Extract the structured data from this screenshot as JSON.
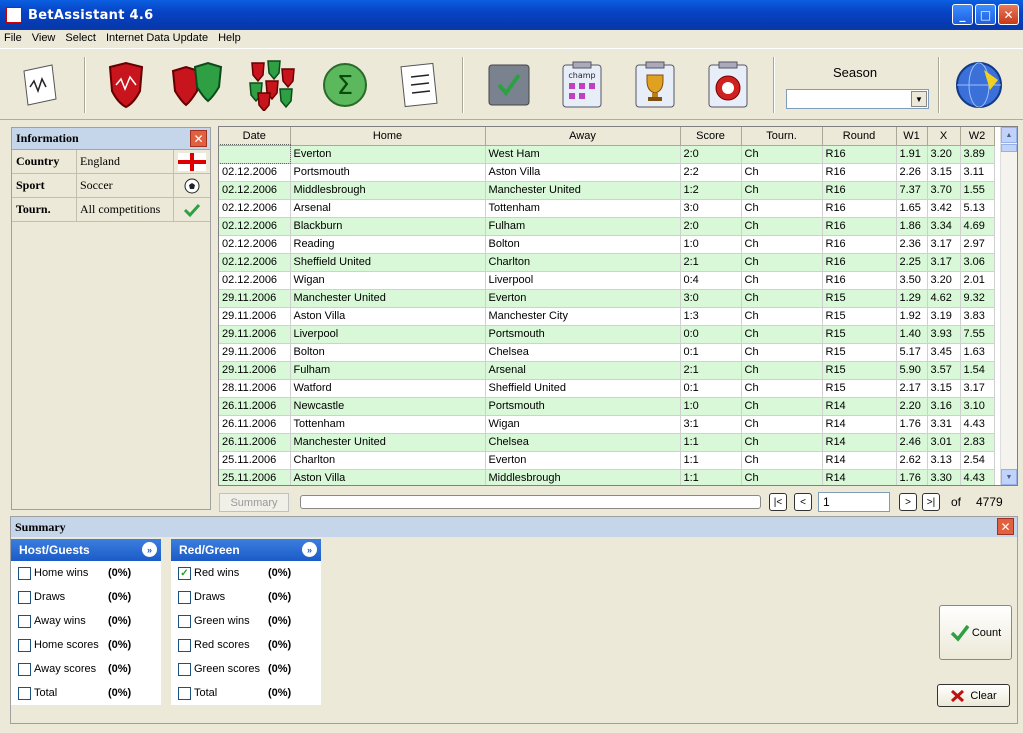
{
  "window": {
    "title": "BetAssistant 4.6",
    "minimize": "_",
    "maximize": "□",
    "close": "✕"
  },
  "menu": [
    "File",
    "View",
    "Select",
    "Internet Data Update",
    "Help"
  ],
  "toolbar": {
    "season_label": "Season",
    "season_value": "",
    "icons": [
      "chart-sheet-icon",
      "red-shield-icon",
      "red-green-shields-icon",
      "multi-shields-icon",
      "sigma-icon",
      "numbered-list-icon",
      "checkmark-icon",
      "championship-icon",
      "trophy-icon",
      "uefa-icon",
      "globe-icon"
    ],
    "champ_label": "champ"
  },
  "info": {
    "title": "Information",
    "rows": [
      {
        "key": "Country",
        "value": "England",
        "icon": "england-flag-icon"
      },
      {
        "key": "Sport",
        "value": "Soccer",
        "icon": "soccer-ball-icon"
      },
      {
        "key": "Tourn.",
        "value": "All competitions",
        "icon": "green-check-icon"
      }
    ]
  },
  "grid": {
    "columns": [
      "Date",
      "Home",
      "Away",
      "Score",
      "Tourn.",
      "Round",
      "W1",
      "X",
      "W2"
    ],
    "rows": [
      [
        "",
        "Everton",
        "West Ham",
        "2:0",
        "Ch",
        "R16",
        "1.91",
        "3.20",
        "3.89"
      ],
      [
        "02.12.2006",
        "Portsmouth",
        "Aston Villa",
        "2:2",
        "Ch",
        "R16",
        "2.26",
        "3.15",
        "3.11"
      ],
      [
        "02.12.2006",
        "Middlesbrough",
        "Manchester United",
        "1:2",
        "Ch",
        "R16",
        "7.37",
        "3.70",
        "1.55"
      ],
      [
        "02.12.2006",
        "Arsenal",
        "Tottenham",
        "3:0",
        "Ch",
        "R16",
        "1.65",
        "3.42",
        "5.13"
      ],
      [
        "02.12.2006",
        "Blackburn",
        "Fulham",
        "2:0",
        "Ch",
        "R16",
        "1.86",
        "3.34",
        "4.69"
      ],
      [
        "02.12.2006",
        "Reading",
        "Bolton",
        "1:0",
        "Ch",
        "R16",
        "2.36",
        "3.17",
        "2.97"
      ],
      [
        "02.12.2006",
        "Sheffield United",
        "Charlton",
        "2:1",
        "Ch",
        "R16",
        "2.25",
        "3.17",
        "3.06"
      ],
      [
        "02.12.2006",
        "Wigan",
        "Liverpool",
        "0:4",
        "Ch",
        "R16",
        "3.50",
        "3.20",
        "2.01"
      ],
      [
        "29.11.2006",
        "Manchester United",
        "Everton",
        "3:0",
        "Ch",
        "R15",
        "1.29",
        "4.62",
        "9.32"
      ],
      [
        "29.11.2006",
        "Aston Villa",
        "Manchester City",
        "1:3",
        "Ch",
        "R15",
        "1.92",
        "3.19",
        "3.83"
      ],
      [
        "29.11.2006",
        "Liverpool",
        "Portsmouth",
        "0:0",
        "Ch",
        "R15",
        "1.40",
        "3.93",
        "7.55"
      ],
      [
        "29.11.2006",
        "Bolton",
        "Chelsea",
        "0:1",
        "Ch",
        "R15",
        "5.17",
        "3.45",
        "1.63"
      ],
      [
        "29.11.2006",
        "Fulham",
        "Arsenal",
        "2:1",
        "Ch",
        "R15",
        "5.90",
        "3.57",
        "1.54"
      ],
      [
        "28.11.2006",
        "Watford",
        "Sheffield United",
        "0:1",
        "Ch",
        "R15",
        "2.17",
        "3.15",
        "3.17"
      ],
      [
        "26.11.2006",
        "Newcastle",
        "Portsmouth",
        "1:0",
        "Ch",
        "R14",
        "2.20",
        "3.16",
        "3.10"
      ],
      [
        "26.11.2006",
        "Tottenham",
        "Wigan",
        "3:1",
        "Ch",
        "R14",
        "1.76",
        "3.31",
        "4.43"
      ],
      [
        "26.11.2006",
        "Manchester United",
        "Chelsea",
        "1:1",
        "Ch",
        "R14",
        "2.46",
        "3.01",
        "2.83"
      ],
      [
        "25.11.2006",
        "Charlton",
        "Everton",
        "1:1",
        "Ch",
        "R14",
        "2.62",
        "3.13",
        "2.54"
      ],
      [
        "25.11.2006",
        "Aston Villa",
        "Middlesbrough",
        "1:1",
        "Ch",
        "R14",
        "1.76",
        "3.30",
        "4.43"
      ]
    ]
  },
  "pager": {
    "summary_label": "Summary",
    "first": "|<",
    "prev": "<",
    "page": "1",
    "next": ">",
    "last": ">|",
    "of_label": "of",
    "total": "4779"
  },
  "summary": {
    "title": "Summary",
    "host_guests": {
      "title": "Host/Guests",
      "items": [
        {
          "label": "Home wins",
          "pct": "(0%)",
          "checked": false
        },
        {
          "label": "Draws",
          "pct": "(0%)",
          "checked": false
        },
        {
          "label": "Away wins",
          "pct": "(0%)",
          "checked": false
        },
        {
          "label": "Home scores",
          "pct": "(0%)",
          "checked": false
        },
        {
          "label": "Away scores",
          "pct": "(0%)",
          "checked": false
        },
        {
          "label": "Total",
          "pct": "(0%)",
          "checked": false
        }
      ]
    },
    "red_green": {
      "title": "Red/Green",
      "items": [
        {
          "label": "Red wins",
          "pct": "(0%)",
          "checked": true
        },
        {
          "label": "Draws",
          "pct": "(0%)",
          "checked": false
        },
        {
          "label": "Green wins",
          "pct": "(0%)",
          "checked": false
        },
        {
          "label": "Red scores",
          "pct": "(0%)",
          "checked": false
        },
        {
          "label": "Green scores",
          "pct": "(0%)",
          "checked": false
        },
        {
          "label": "Total",
          "pct": "(0%)",
          "checked": false
        }
      ]
    },
    "count_label": "Count",
    "clear_label": "Clear"
  },
  "colors": {
    "row_alt": "#d8f8d8",
    "title_bar": "#0843c4",
    "panel_head": "#c6d6ea",
    "box_head": "#1b5bc8"
  }
}
